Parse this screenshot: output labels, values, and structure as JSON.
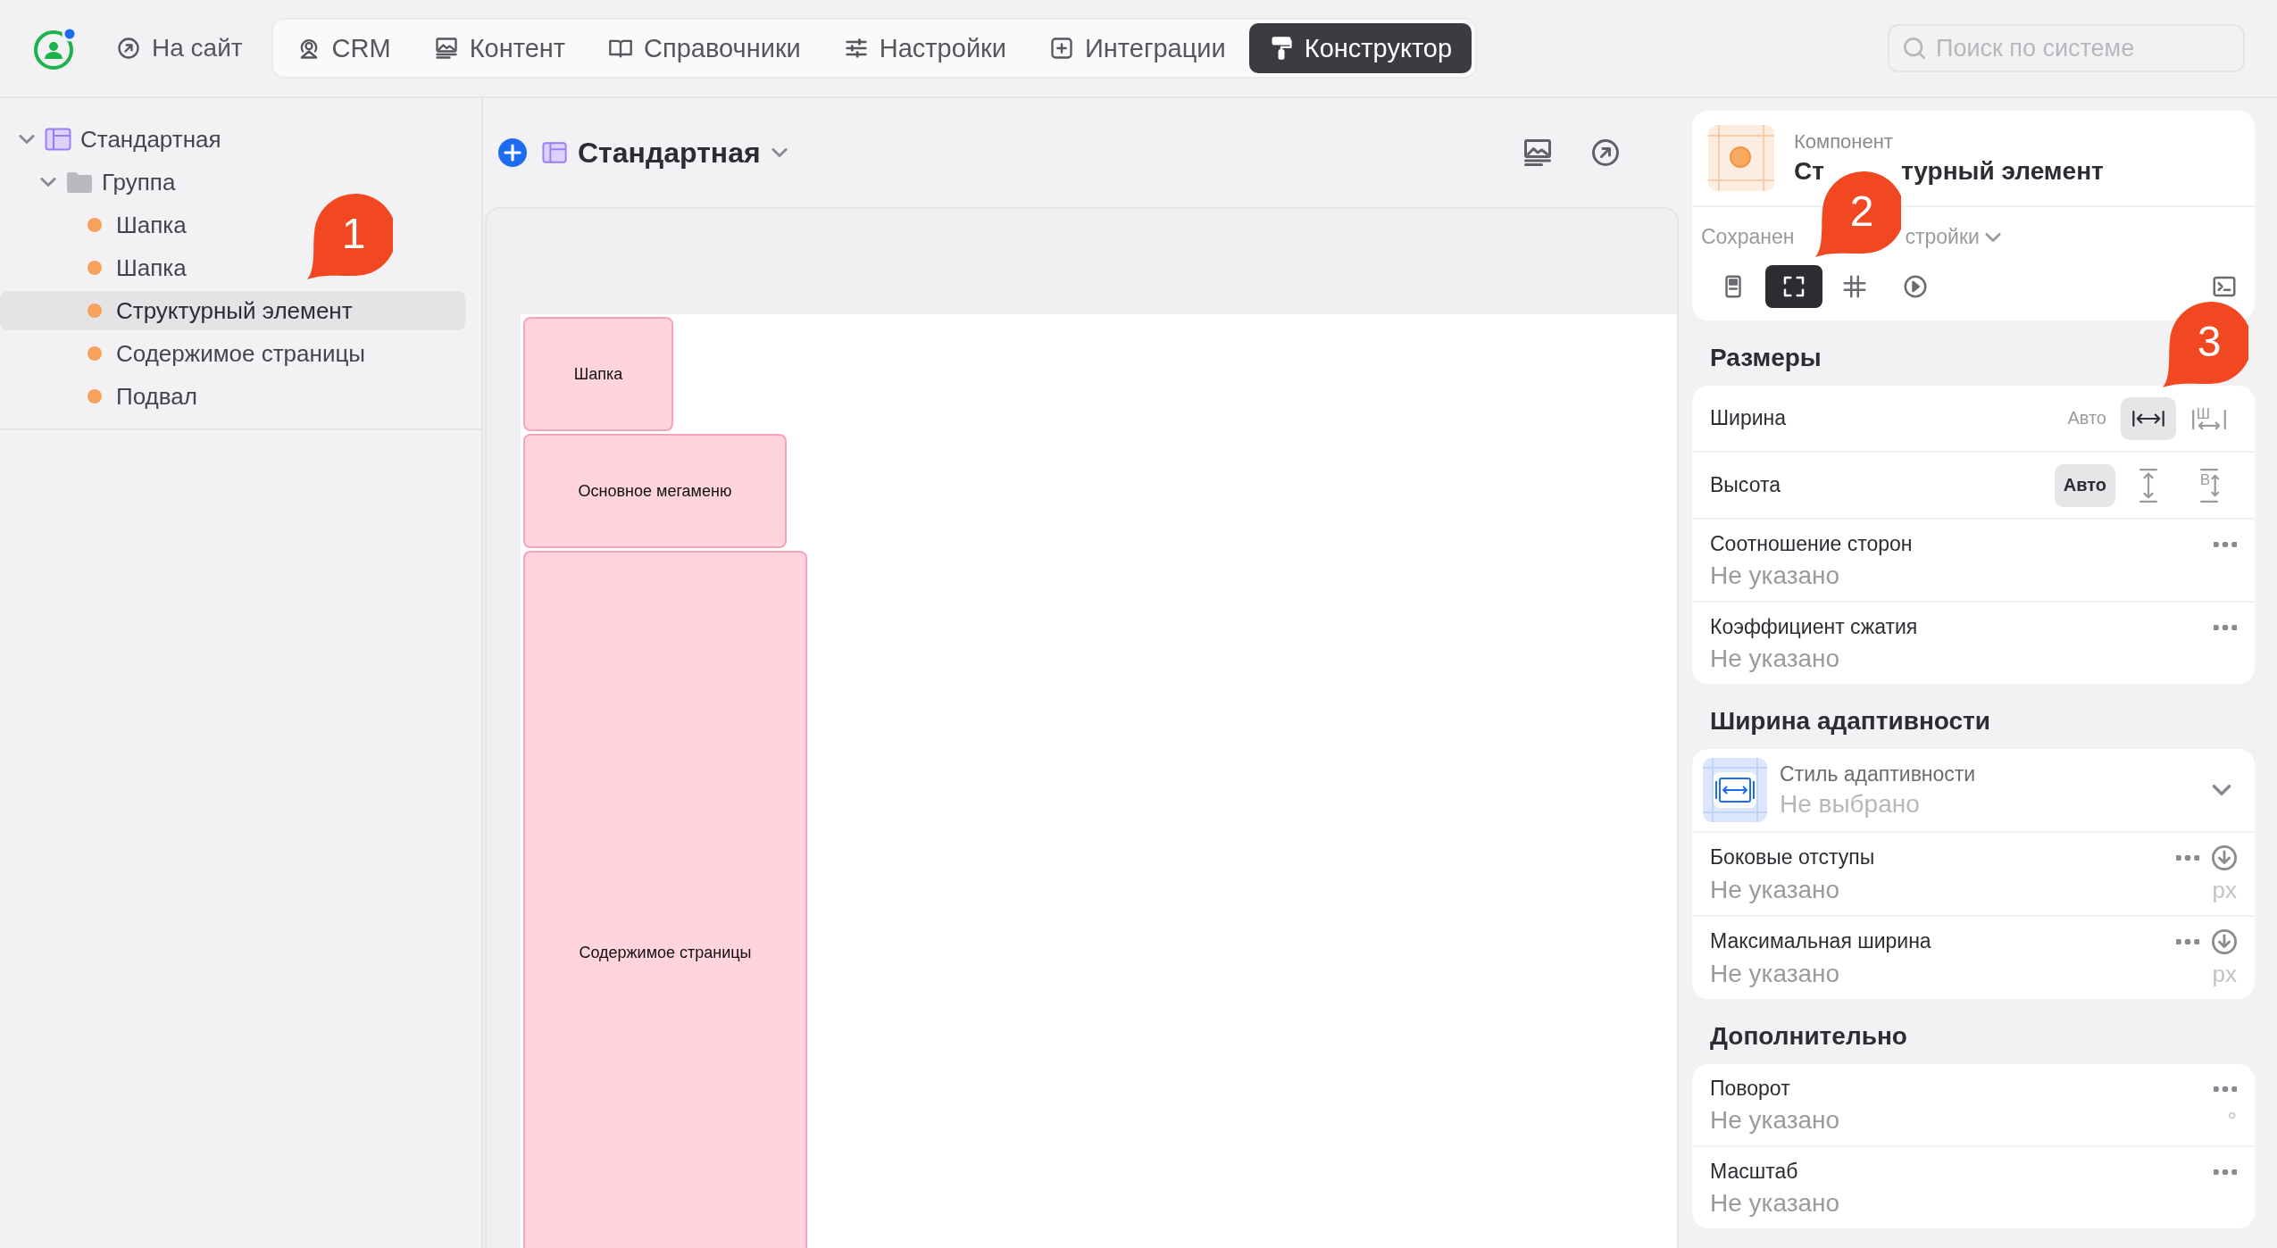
{
  "topbar": {
    "site_link": "На сайт",
    "tabs": [
      {
        "label": "CRM",
        "selected": false
      },
      {
        "label": "Контент",
        "selected": false
      },
      {
        "label": "Справочники",
        "selected": false
      },
      {
        "label": "Настройки",
        "selected": false
      },
      {
        "label": "Интеграции",
        "selected": false
      },
      {
        "label": "Конструктор",
        "selected": true
      }
    ],
    "search": {
      "placeholder": "Поиск по системе"
    }
  },
  "tree": [
    {
      "label": "Стандартная",
      "kind": "layout",
      "expanded": true,
      "selected": false,
      "children": [
        {
          "label": "Группа",
          "kind": "folder",
          "expanded": true,
          "selected": false,
          "children": [
            {
              "label": "Шапка",
              "kind": "element",
              "selected": false
            },
            {
              "label": "Шапка",
              "kind": "element",
              "selected": false
            },
            {
              "label": "Структурный элемент",
              "kind": "element",
              "selected": true
            },
            {
              "label": "Содержимое страницы",
              "kind": "element",
              "selected": false
            },
            {
              "label": "Подвал",
              "kind": "element",
              "selected": false
            }
          ]
        }
      ]
    }
  ],
  "editor": {
    "title": "Стандартная",
    "blocks": [
      {
        "label": "Шапка"
      },
      {
        "label": "Основное мегаменю"
      },
      {
        "label": "Содержимое страницы"
      }
    ]
  },
  "inspector": {
    "caption": "Компонент",
    "name_parts": [
      "Ст",
      "турный элемент"
    ],
    "presets_parts": [
      "Сохранен",
      "стройки"
    ],
    "tools": [
      {
        "selected": false
      },
      {
        "selected": true
      },
      {
        "selected": false
      },
      {
        "selected": false
      },
      {
        "selected": false
      }
    ],
    "sections": [
      {
        "title": "Размеры",
        "rows": [
          {
            "kind": "mode",
            "label": "Ширина",
            "options": [
              {
                "kind": "text",
                "label": "Авто",
                "selected": false
              },
              {
                "kind": "stretch-h",
                "selected": true
              },
              {
                "kind": "fixed-h",
                "glyph": "Ш",
                "selected": false
              }
            ]
          },
          {
            "kind": "mode",
            "label": "Высота",
            "options": [
              {
                "kind": "text",
                "label": "Авто",
                "selected": true
              },
              {
                "kind": "stretch-v",
                "selected": false
              },
              {
                "kind": "fixed-v",
                "glyph": "В",
                "selected": false
              }
            ]
          },
          {
            "kind": "value",
            "label": "Соотношение сторон",
            "value": "Не указано"
          },
          {
            "kind": "value",
            "label": "Коэффициент сжатия",
            "value": "Не указано"
          }
        ]
      },
      {
        "title": "Ширина адаптивности",
        "rows": [
          {
            "kind": "select",
            "label": "Стиль адаптивности",
            "value": "Не выбрано"
          },
          {
            "kind": "value",
            "label": "Боковые отступы",
            "value": "Не указано",
            "unit": "px",
            "resettable": true
          },
          {
            "kind": "value",
            "label": "Максимальная ширина",
            "value": "Не указано",
            "unit": "px",
            "resettable": true
          }
        ]
      },
      {
        "title": "Дополнительно",
        "rows": [
          {
            "kind": "value",
            "label": "Поворот",
            "value": "Не указано",
            "unit": "°"
          },
          {
            "kind": "value",
            "label": "Масштаб",
            "value": "Не указано"
          }
        ]
      }
    ]
  },
  "callouts": [
    {
      "number": "1"
    },
    {
      "number": "2"
    },
    {
      "number": "3"
    }
  ]
}
